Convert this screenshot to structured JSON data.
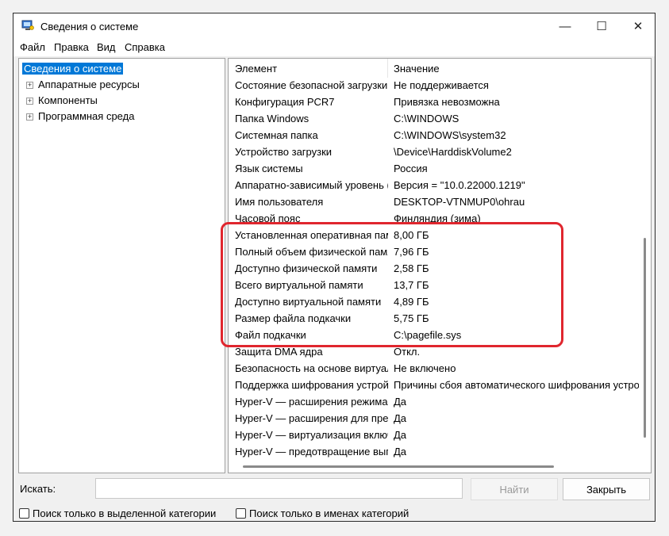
{
  "window": {
    "title": "Сведения о системе",
    "minimize_glyph": "—",
    "maximize_glyph": "☐",
    "close_glyph": "✕"
  },
  "menu": [
    {
      "label": "Файл"
    },
    {
      "label": "Правка"
    },
    {
      "label": "Вид"
    },
    {
      "label": "Справка"
    }
  ],
  "tree": {
    "root": "Сведения о системе",
    "children": [
      {
        "label": "Аппаратные ресурсы"
      },
      {
        "label": "Компоненты"
      },
      {
        "label": "Программная среда"
      }
    ]
  },
  "table": {
    "headers": {
      "name": "Элемент",
      "value": "Значение"
    },
    "rows": [
      {
        "name": "Состояние безопасной загрузки",
        "value": "Не поддерживается"
      },
      {
        "name": "Конфигурация PCR7",
        "value": "Привязка невозможна"
      },
      {
        "name": "Папка Windows",
        "value": "C:\\WINDOWS"
      },
      {
        "name": "Системная папка",
        "value": "C:\\WINDOWS\\system32"
      },
      {
        "name": "Устройство загрузки",
        "value": "\\Device\\HarddiskVolume2"
      },
      {
        "name": "Язык системы",
        "value": "Россия"
      },
      {
        "name": "Аппаратно-зависимый уровень (HAL)",
        "value": "Версия = \"10.0.22000.1219\""
      },
      {
        "name": "Имя пользователя",
        "value": "DESKTOP-VTNMUP0\\ohrau"
      },
      {
        "name": "Часовой пояс",
        "value": "Финляндия (зима)"
      },
      {
        "name": "Установленная оперативная память (RAM)",
        "value": "8,00 ГБ"
      },
      {
        "name": "Полный объем физической памяти",
        "value": "7,96 ГБ"
      },
      {
        "name": "Доступно физической памяти",
        "value": "2,58 ГБ"
      },
      {
        "name": "Всего виртуальной памяти",
        "value": "13,7 ГБ"
      },
      {
        "name": "Доступно виртуальной памяти",
        "value": "4,89 ГБ"
      },
      {
        "name": "Размер файла подкачки",
        "value": "5,75 ГБ"
      },
      {
        "name": "Файл подкачки",
        "value": "C:\\pagefile.sys"
      },
      {
        "name": "Защита DMA ядра",
        "value": "Откл."
      },
      {
        "name": "Безопасность на основе виртуализации",
        "value": "Не включено"
      },
      {
        "name": "Поддержка шифрования устройства",
        "value": "Причины сбоя автоматического шифрования устройства"
      },
      {
        "name": "Hyper-V — расширения режима мониторинга",
        "value": "Да"
      },
      {
        "name": "Hyper-V — расширения для преобразования адресов",
        "value": "Да"
      },
      {
        "name": "Hyper-V — виртуализация включена",
        "value": "Да"
      },
      {
        "name": "Hyper-V — предотвращение выполнения данных",
        "value": "Да"
      }
    ]
  },
  "search": {
    "label": "Искать:",
    "value": "",
    "find_button": "Найти",
    "close_button": "Закрыть",
    "option_selected_category": "Поиск только в выделенной категории",
    "option_category_names": "Поиск только в именах категорий"
  },
  "colors": {
    "selection": "#0078d7",
    "highlight_frame": "#e0262e"
  }
}
